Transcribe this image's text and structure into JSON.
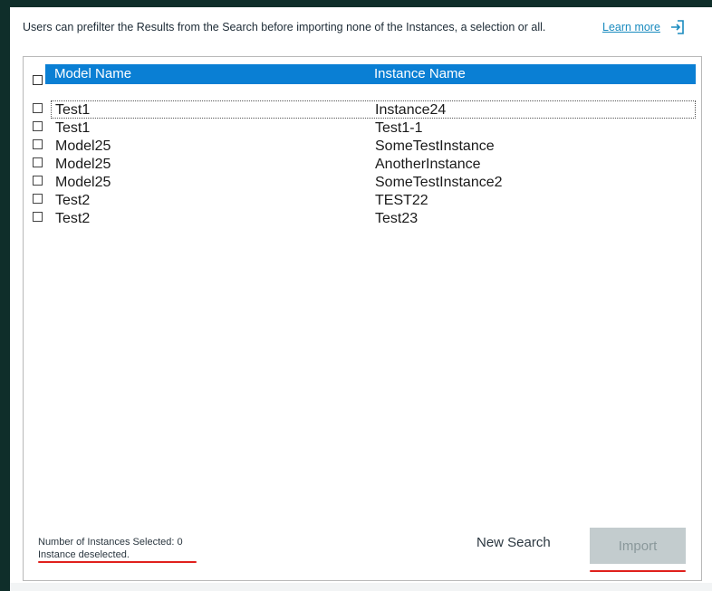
{
  "header": {
    "description": "Users can prefilter the Results from the Search before importing none of the Instances, a selection or all.",
    "learn_more": "Learn more"
  },
  "table": {
    "columns": [
      "Model Name",
      "Instance Name"
    ],
    "rows": [
      {
        "model": "Test1",
        "instance": "Instance24"
      },
      {
        "model": "Test1",
        "instance": "Test1-1"
      },
      {
        "model": "Model25",
        "instance": "SomeTestInstance"
      },
      {
        "model": "Model25",
        "instance": "AnotherInstance"
      },
      {
        "model": "Model25",
        "instance": "SomeTestInstance2"
      },
      {
        "model": "Test2",
        "instance": "TEST22"
      },
      {
        "model": "Test2",
        "instance": "Test23"
      }
    ]
  },
  "footer": {
    "selected_count": "Number of Instances Selected: 0",
    "status": "Instance deselected.",
    "new_search": "New Search",
    "import": "Import"
  },
  "colors": {
    "header_bg": "#0a7fd4",
    "highlight": "#e0201c",
    "import_disabled": "#c3ccce",
    "link": "#1a8bbf"
  },
  "icons": {
    "learn_more": "external-link-icon"
  }
}
